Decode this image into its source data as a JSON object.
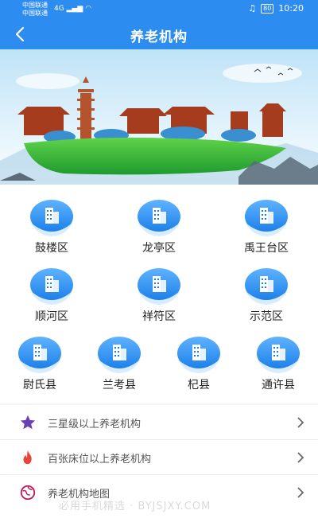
{
  "status_bar": {
    "carrier_1": "中国联通",
    "carrier_2": "中国联通",
    "signal": "4G",
    "battery": "80",
    "time": "10:20"
  },
  "header": {
    "title": "养老机构",
    "color": "#2d8cf0"
  },
  "districts": [
    {
      "label": "鼓楼区",
      "icon": "building-icon"
    },
    {
      "label": "龙亭区",
      "icon": "building-icon"
    },
    {
      "label": "禹王台区",
      "icon": "building-icon"
    },
    {
      "label": "顺河区",
      "icon": "building-icon"
    },
    {
      "label": "祥符区",
      "icon": "building-icon"
    },
    {
      "label": "示范区",
      "icon": "building-icon"
    },
    {
      "label": "尉氏县",
      "icon": "building-icon"
    },
    {
      "label": "兰考县",
      "icon": "building-icon"
    },
    {
      "label": "杞县",
      "icon": "building-icon"
    },
    {
      "label": "通许县",
      "icon": "building-icon"
    }
  ],
  "list": [
    {
      "label": "三星级以上养老机构",
      "icon": "star-icon",
      "color": "#6a3fb5"
    },
    {
      "label": "百张床位以上养老机构",
      "icon": "flame-icon",
      "color": "#e8443a"
    },
    {
      "label": "养老机构地图",
      "icon": "map-icon",
      "color": "#c2185b"
    }
  ],
  "watermark": "必用手机精选 · BYJSJXY.COM"
}
